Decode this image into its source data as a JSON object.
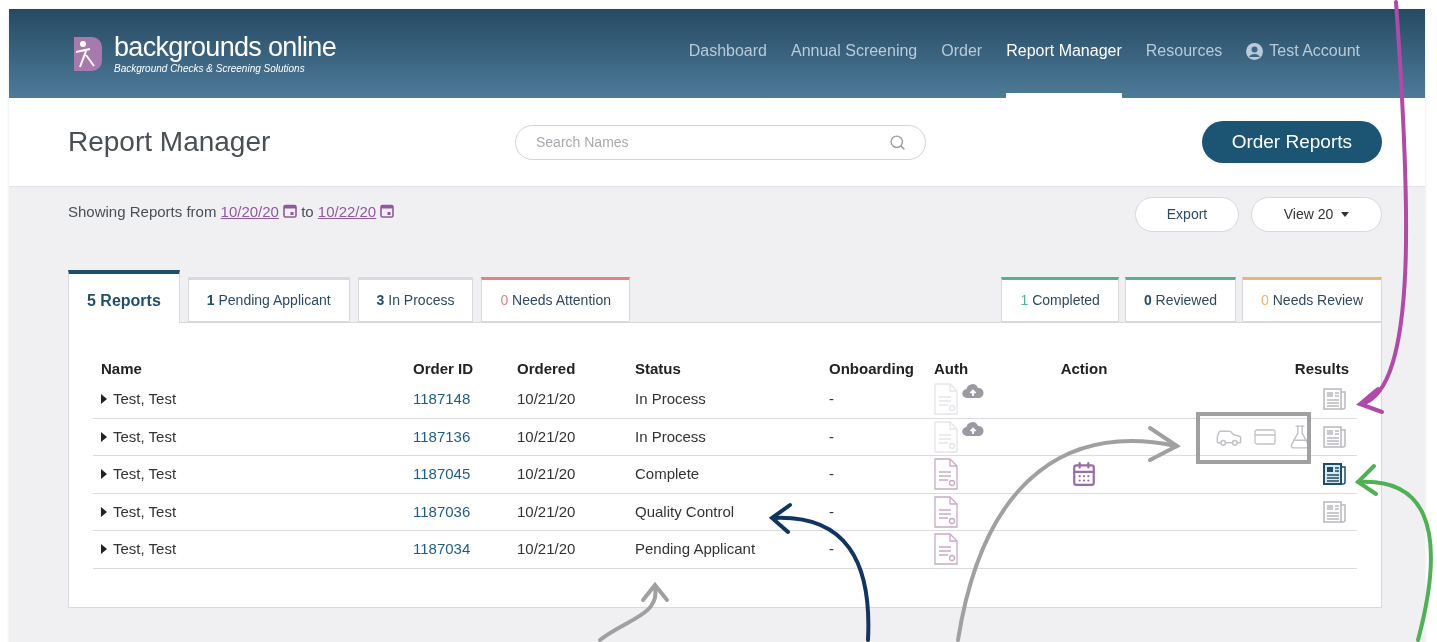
{
  "brand": {
    "name": "backgrounds online",
    "tagline": "Background Checks & Screening Solutions"
  },
  "nav": [
    {
      "label": "Dashboard",
      "selected": false,
      "kind": "link"
    },
    {
      "label": "Annual Screening",
      "selected": false,
      "kind": "link"
    },
    {
      "label": "Order",
      "selected": false,
      "kind": "link"
    },
    {
      "label": "Report Manager",
      "selected": true,
      "kind": "link"
    },
    {
      "label": "Resources",
      "selected": false,
      "kind": "link"
    },
    {
      "label": "Test Account",
      "selected": false,
      "kind": "account"
    }
  ],
  "page_title": "Report Manager",
  "search": {
    "placeholder": "Search Names"
  },
  "order_button": "Order Reports",
  "date_range": {
    "prefix": "Showing Reports from",
    "from": "10/20/20",
    "joiner": "to",
    "to": "10/22/20"
  },
  "export_button": "Export",
  "view_select": "View 20",
  "tabs_left": [
    {
      "count": "5",
      "label": "Reports",
      "selected": true,
      "color": "#1f4e6b",
      "tinted": false
    },
    {
      "count": "1",
      "label": "Pending Applicant",
      "selected": false,
      "tinted": false
    },
    {
      "count": "3",
      "label": "In Process",
      "selected": false,
      "tinted": false
    },
    {
      "count": "0",
      "label": "Needs Attention",
      "selected": false,
      "color": "#e88080",
      "tinted": true
    }
  ],
  "tabs_right": [
    {
      "count": "1",
      "label": "Completed",
      "selected": false,
      "color": "#4db58f",
      "tinted": true
    },
    {
      "count": "0",
      "label": "Reviewed",
      "selected": false,
      "color": "#4db58f",
      "tinted": false
    },
    {
      "count": "0",
      "label": "Needs Review",
      "selected": false,
      "color": "#f2b469",
      "tinted": true
    }
  ],
  "table": {
    "columns": [
      "Name",
      "Order ID",
      "Ordered",
      "Status",
      "Onboarding",
      "Auth",
      "Action",
      "Results"
    ],
    "rows": [
      {
        "name": "Test, Test",
        "order_id": "1187148",
        "ordered": "10/21/20",
        "status": "In Process",
        "onboarding": "-",
        "auth_signed": false,
        "upload": true,
        "schedule": false,
        "services": false,
        "has_results": true,
        "results_new": false
      },
      {
        "name": "Test, Test",
        "order_id": "1187136",
        "ordered": "10/21/20",
        "status": "In Process",
        "onboarding": "-",
        "auth_signed": false,
        "upload": true,
        "schedule": false,
        "services": true,
        "has_results": true,
        "results_new": false
      },
      {
        "name": "Test, Test",
        "order_id": "1187045",
        "ordered": "10/21/20",
        "status": "Complete",
        "onboarding": "-",
        "auth_signed": true,
        "upload": false,
        "schedule": true,
        "services": false,
        "has_results": true,
        "results_new": true
      },
      {
        "name": "Test, Test",
        "order_id": "1187036",
        "ordered": "10/21/20",
        "status": "Quality Control",
        "onboarding": "-",
        "auth_signed": true,
        "upload": false,
        "schedule": false,
        "services": false,
        "has_results": true,
        "results_new": false
      },
      {
        "name": "Test, Test",
        "order_id": "1187034",
        "ordered": "10/21/20",
        "status": "Pending Applicant",
        "onboarding": "-",
        "auth_signed": true,
        "upload": false,
        "schedule": false,
        "services": false,
        "has_results": false
      }
    ]
  }
}
